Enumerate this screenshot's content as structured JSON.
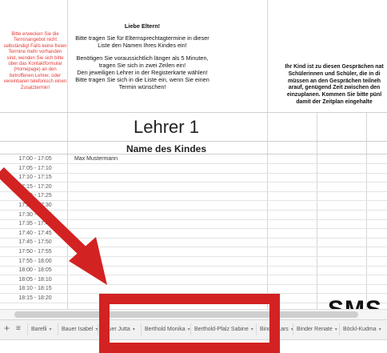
{
  "notice_left": "Bitte erwecken Sie die Terminangebot nicht selbständig! Falls keine freien Termine mehr vorhanden sind, wenden Sie sich bitte über das Kontaktformular (Homepage) an den betroffenen Lehrer, oder vereinbaren telefonisch einen Zusatztermin!",
  "main_text": {
    "greeting": "Liebe Eltern!",
    "line1": "Bitte tragen Sie für Elternsprechtagtermine in dieser Liste den Namen Ihres Kindes ein!",
    "line2": "Benötigen Sie voraussichtlich länger als 5 Minuten, tragen Sie sich in zwei Zeilen ein!",
    "line3": "Den jeweiligen Lehrer in der Registerkarte wählen!",
    "line4": "Bitte tragen Sie sich in die Liste ein, wenn Sie einen Termin wünschen!"
  },
  "right_text": {
    "line1": "Ihr Kind ist zu diesen Gesprächen nat",
    "line2": "Schülerinnen und Schüler, die in di",
    "line3": "müssen an den Gesprächen teilneh",
    "line4": "arauf, genügend Zeit zwischen den",
    "line5": "einzuplanen. Kommen Sie bitte pünl",
    "line6": "damit der Zeitplan eingehalte"
  },
  "teacher_title": "Lehrer 1",
  "column_header": "Name des Kindes",
  "time_slots": [
    "17:00 - 17:05",
    "17:05 - 17:10",
    "17:10 - 17:15",
    "17:15 - 17:20",
    "17:20 - 17:25",
    "17:25 - 17:30",
    "17:30 - 17:35",
    "17:35 - 17:40",
    "17:40 - 17:45",
    "17:45 - 17:50",
    "17:50 - 17:55",
    "17:55 - 18:00",
    "18:00 - 18:05",
    "18:05 - 18:10",
    "18:10 - 18:15",
    "18:15 - 18:20"
  ],
  "first_entry": "Max Mustermann",
  "logo_text": "SMS",
  "tabs": [
    "Barelli",
    "Bauer Isabel",
    "Bauer Jutta",
    "Berthold Monika",
    "Berthold-Pfalz Sabine",
    "Binder Lars",
    "Binder Renate",
    "Böckl-Kudma"
  ],
  "colors": {
    "accent_red": "#d32222",
    "notice_red": "#e53935"
  }
}
